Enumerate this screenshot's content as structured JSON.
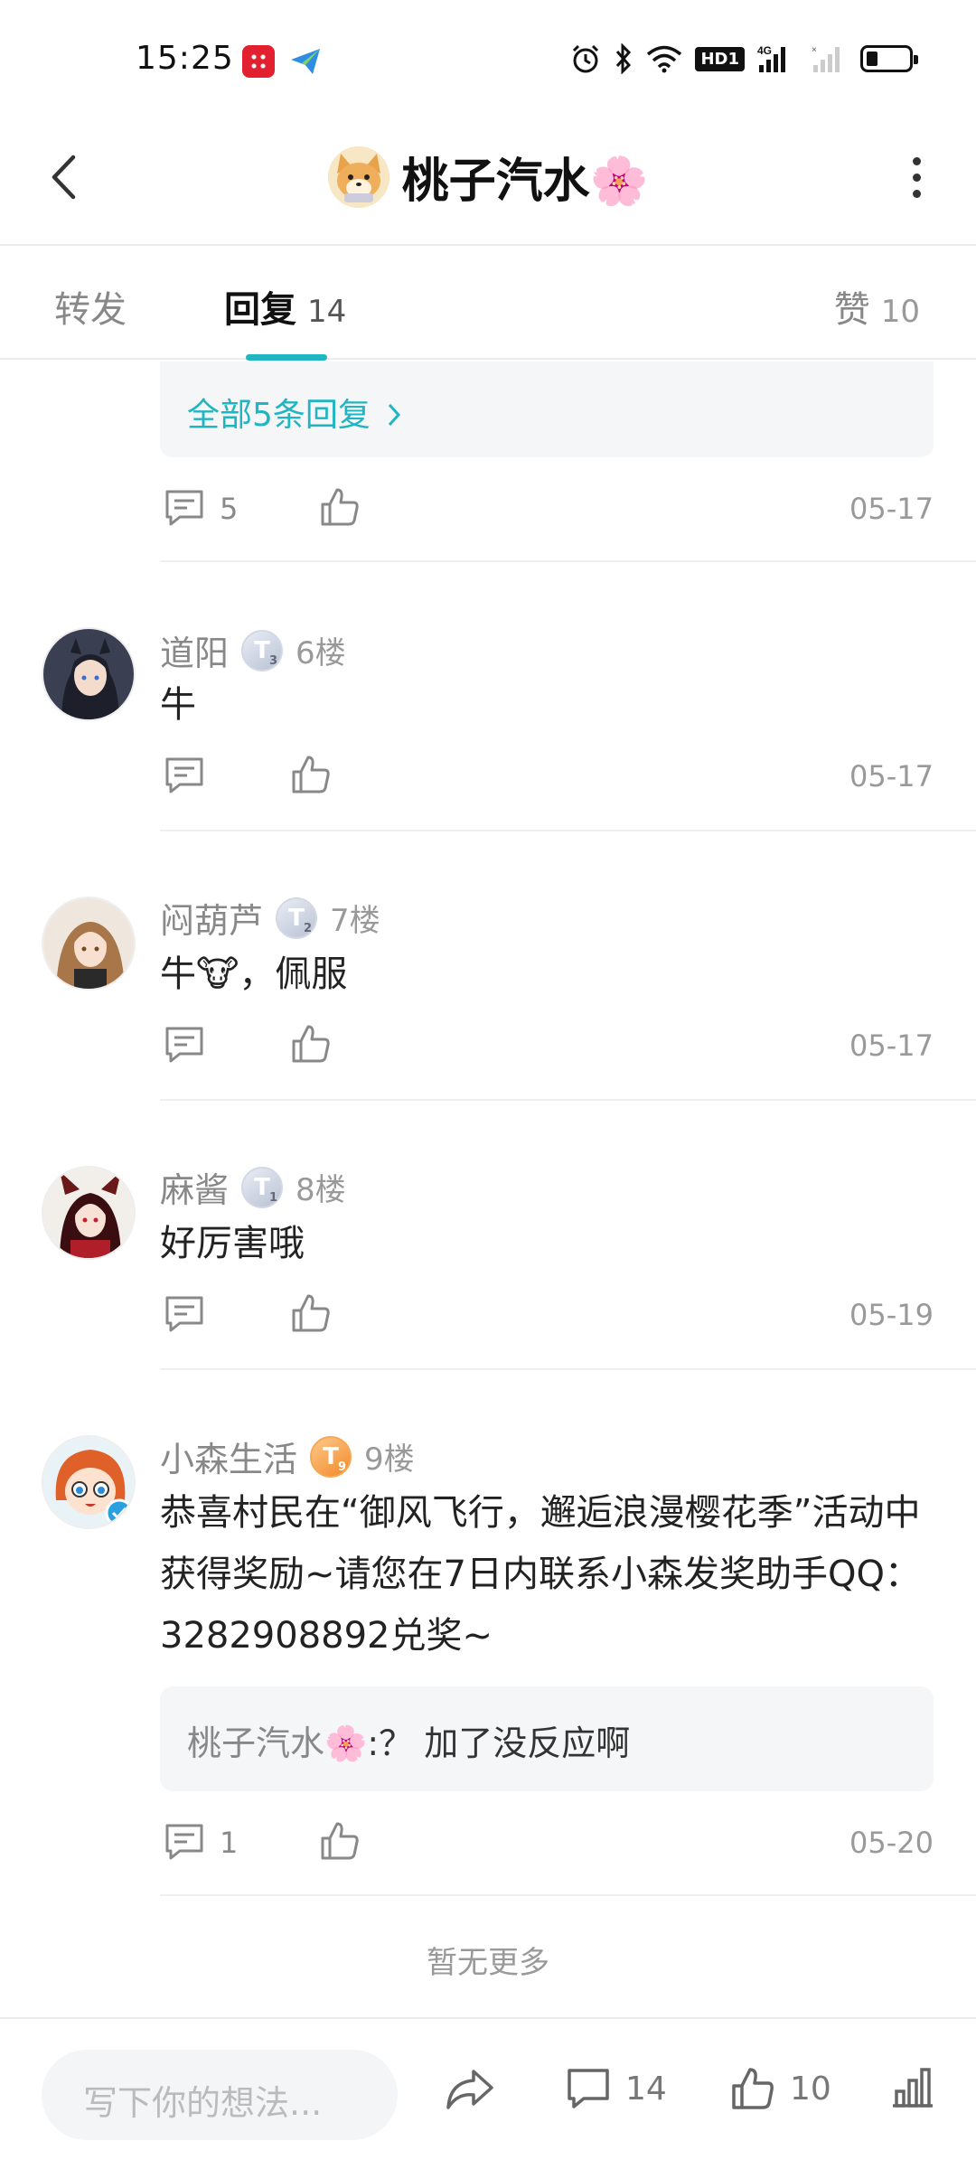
{
  "status_bar": {
    "time": "15:25",
    "hd_label": "HD1",
    "network_label": "4G"
  },
  "header": {
    "title": "桃子汽水🌸"
  },
  "tabs": [
    {
      "label": "转发",
      "count": ""
    },
    {
      "label": "回复",
      "count": "14"
    },
    {
      "label": "赞",
      "count": "10"
    }
  ],
  "prev_comment": {
    "all_replies_label": "全部5条回复",
    "reply_count": "5",
    "date": "05-17"
  },
  "comments": [
    {
      "user": "道阳",
      "level": "T",
      "level_num": "3",
      "floor": "6楼",
      "text": "牛",
      "reply_count": "",
      "date": "05-17"
    },
    {
      "user": "闷葫芦",
      "level": "T",
      "level_num": "2",
      "floor": "7楼",
      "text": "牛🐮，佩服",
      "reply_count": "",
      "date": "05-17"
    },
    {
      "user": "麻酱",
      "level": "T",
      "level_num": "1",
      "floor": "8楼",
      "text": "好厉害哦",
      "reply_count": "",
      "date": "05-19"
    },
    {
      "user": "小森生活",
      "level": "T",
      "level_num": "9",
      "floor": "9楼",
      "text": "恭喜村民在“御风飞行，邂逅浪漫樱花季”活动中获得奖励~请您在7日内联系小森发奖助手QQ：3282908892兑奖~",
      "sub_reply_user": "桃子汽水🌸",
      "sub_reply_text": ":？ 加了没反应啊",
      "reply_count": "1",
      "date": "05-20"
    }
  ],
  "footer_note": "暂无更多",
  "bottom_bar": {
    "input_placeholder": "写下你的想法...",
    "comment_count": "14",
    "like_count": "10"
  },
  "colors": {
    "accent": "#1fb5c2",
    "muted_text": "#999999",
    "reply_bg": "#f5f6f7"
  }
}
